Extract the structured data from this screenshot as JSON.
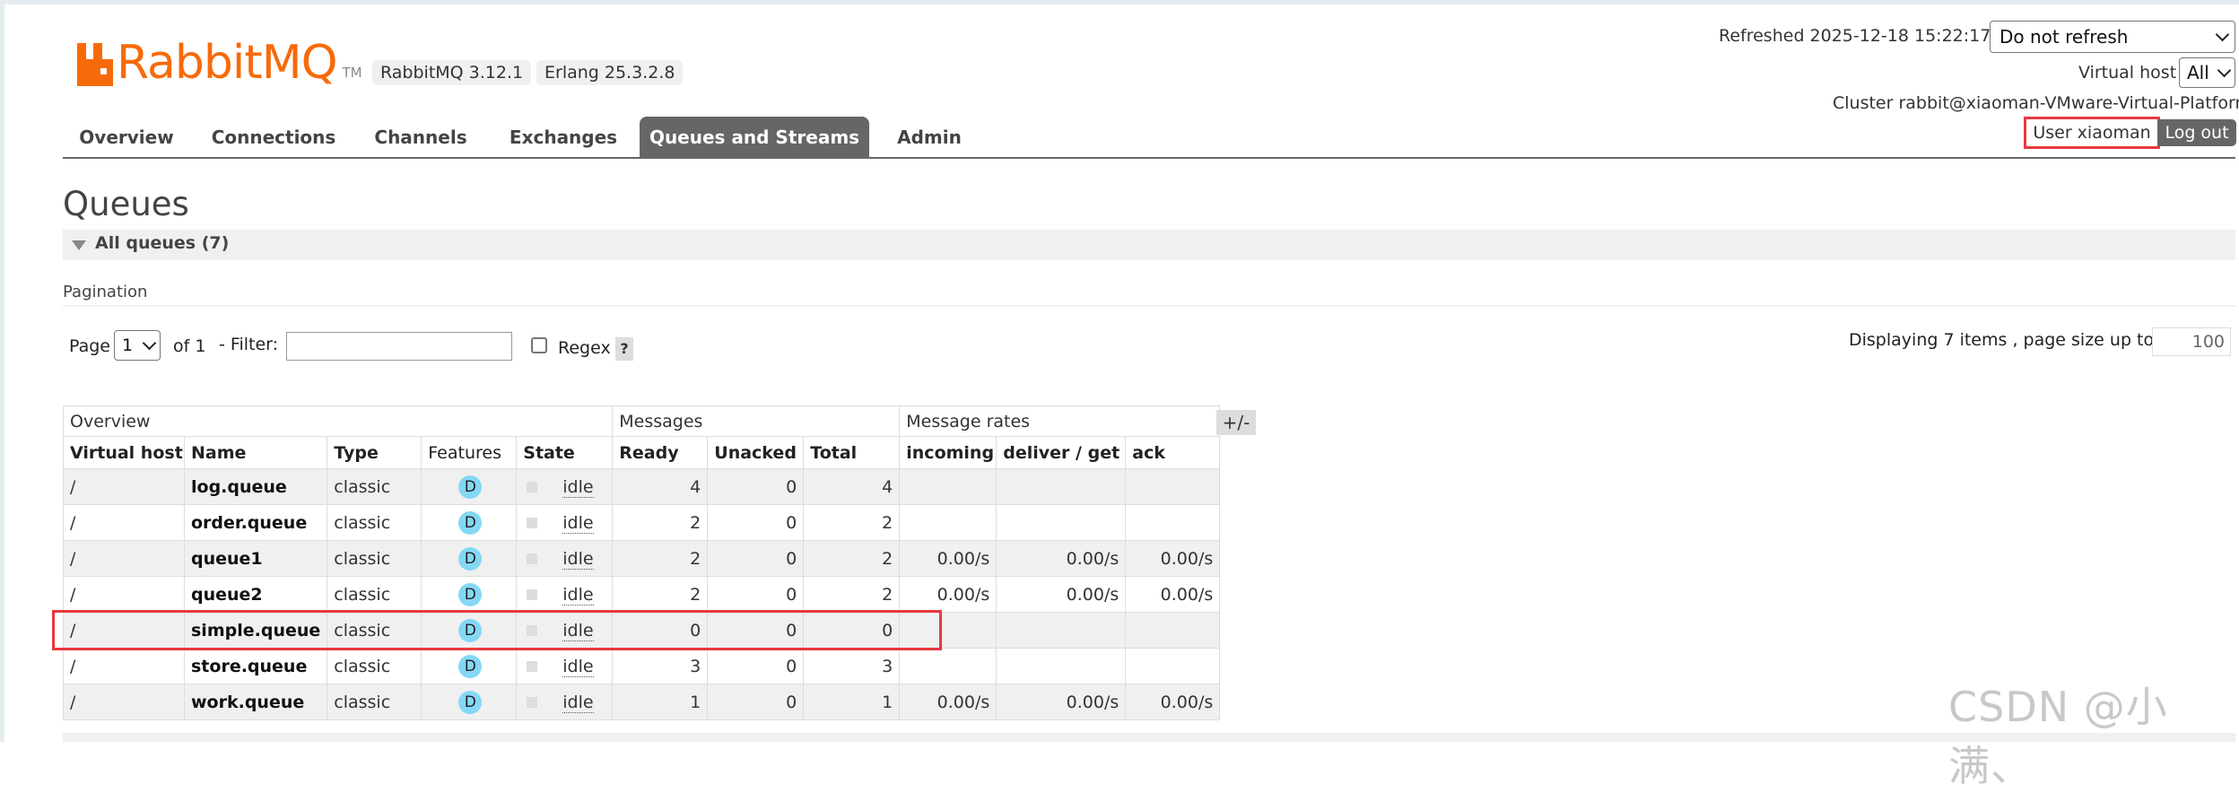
{
  "brand": {
    "logo_text": "RabbitMQ",
    "trademark": "TM",
    "color": "#f76a0a"
  },
  "versions": {
    "rabbitmq": "RabbitMQ 3.12.1",
    "erlang": "Erlang 25.3.2.8"
  },
  "header": {
    "refreshed": "Refreshed 2025-12-18 15:22:17",
    "refresh_select": "Do not refresh",
    "vhost_label": "Virtual host",
    "vhost_select": "All",
    "cluster": "Cluster rabbit@xiaoman-VMware-Virtual-Platform",
    "user": "User xiaoman",
    "logout": "Log out"
  },
  "nav": {
    "items": [
      "Overview",
      "Connections",
      "Channels",
      "Exchanges",
      "Queues and Streams",
      "Admin"
    ],
    "active": "Queues and Streams"
  },
  "page": {
    "title": "Queues",
    "section": "All queues (7)",
    "pagination_label": "Pagination"
  },
  "pagination": {
    "page_label": "Page",
    "page_value": "1",
    "of_label": "of 1",
    "filter_label": "- Filter:",
    "filter_value": "",
    "regex_label": "Regex",
    "help": "?",
    "displaying": "Displaying 7 items , page size up to:",
    "page_size": "100"
  },
  "table": {
    "groups": [
      "Overview",
      "Messages",
      "Message rates"
    ],
    "toggle": "+/-",
    "columns": [
      "Virtual host",
      "Name",
      "Type",
      "Features",
      "State",
      "Ready",
      "Unacked",
      "Total",
      "incoming",
      "deliver / get",
      "ack"
    ],
    "rows": [
      {
        "vhost": "/",
        "name": "log.queue",
        "type": "classic",
        "feature": "D",
        "state": "idle",
        "ready": "4",
        "unacked": "0",
        "total": "4",
        "incoming": "",
        "deliver": "",
        "ack": ""
      },
      {
        "vhost": "/",
        "name": "order.queue",
        "type": "classic",
        "feature": "D",
        "state": "idle",
        "ready": "2",
        "unacked": "0",
        "total": "2",
        "incoming": "",
        "deliver": "",
        "ack": ""
      },
      {
        "vhost": "/",
        "name": "queue1",
        "type": "classic",
        "feature": "D",
        "state": "idle",
        "ready": "2",
        "unacked": "0",
        "total": "2",
        "incoming": "0.00/s",
        "deliver": "0.00/s",
        "ack": "0.00/s"
      },
      {
        "vhost": "/",
        "name": "queue2",
        "type": "classic",
        "feature": "D",
        "state": "idle",
        "ready": "2",
        "unacked": "0",
        "total": "2",
        "incoming": "0.00/s",
        "deliver": "0.00/s",
        "ack": "0.00/s"
      },
      {
        "vhost": "/",
        "name": "simple.queue",
        "type": "classic",
        "feature": "D",
        "state": "idle",
        "ready": "0",
        "unacked": "0",
        "total": "0",
        "incoming": "",
        "deliver": "",
        "ack": ""
      },
      {
        "vhost": "/",
        "name": "store.queue",
        "type": "classic",
        "feature": "D",
        "state": "idle",
        "ready": "3",
        "unacked": "0",
        "total": "3",
        "incoming": "",
        "deliver": "",
        "ack": ""
      },
      {
        "vhost": "/",
        "name": "work.queue",
        "type": "classic",
        "feature": "D",
        "state": "idle",
        "ready": "1",
        "unacked": "0",
        "total": "1",
        "incoming": "0.00/s",
        "deliver": "0.00/s",
        "ack": "0.00/s"
      }
    ]
  },
  "watermark": "CSDN @小满、",
  "colors": {
    "highlight": "#e8393f",
    "feature_badge": "#84d8f5",
    "nav_active": "#666666"
  }
}
